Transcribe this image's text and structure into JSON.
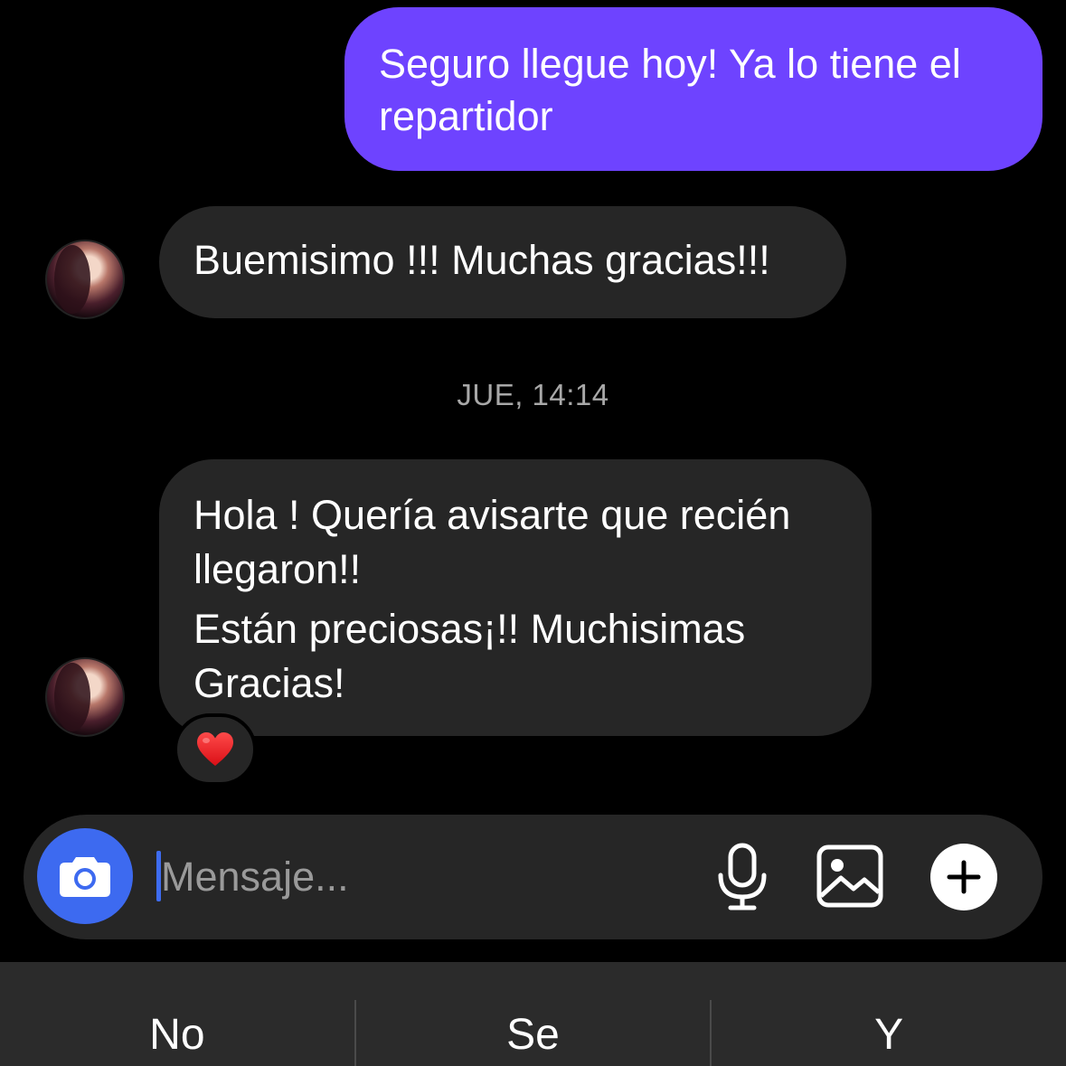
{
  "messages": {
    "outgoing_1": "Seguro llegue hoy! Ya lo tiene el repartidor",
    "incoming_1": "Buemisimo !!! Muchas gracias!!!",
    "timestamp": "JUE, 14:14",
    "incoming_2": {
      "line_1": "Hola ! Quería avisarte que recién",
      "line_2": "llegaron!!",
      "line_3": "Están preciosas¡!!  Muchisimas",
      "line_4": "Gracias!"
    },
    "reaction": "❤️"
  },
  "composer": {
    "placeholder": "Mensaje...",
    "icons": [
      "camera-icon",
      "microphone-icon",
      "gallery-icon",
      "plus-icon"
    ]
  },
  "keyboard": {
    "suggestions": [
      "No",
      "Se",
      "Y"
    ]
  },
  "colors": {
    "outgoing_bubble": "#6e43ff",
    "incoming_bubble": "#262626",
    "camera_button": "#3d6af0",
    "background": "#000000"
  }
}
